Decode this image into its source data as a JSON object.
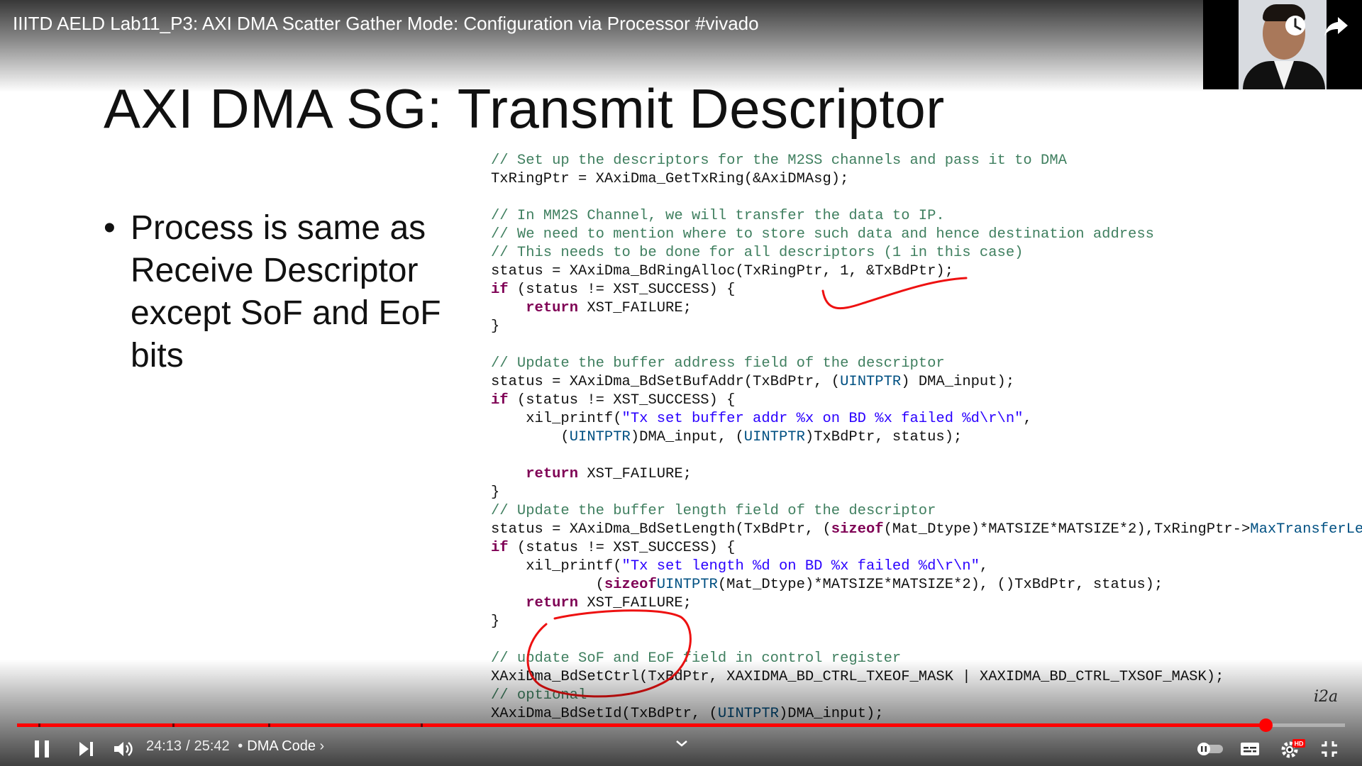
{
  "video": {
    "title": "IIITD AELD Lab11_P3: AXI DMA Scatter Gather Mode: Configuration via Processor #vivado"
  },
  "slide": {
    "title": "AXI DMA SG: Transmit Descriptor",
    "bullet_marker": "•",
    "bullet": "Process is same as Receive Descriptor except SoF and EoF bits",
    "code": [
      {
        "c": "// Set up the descriptors for the M2SS channels and pass it to DMA"
      },
      {
        "a": "TxRingPtr = XAxiDma_GetTxRing(&AxiDMAsg);"
      },
      {
        "a": ""
      },
      {
        "c": "// In MM2S Channel, we will transfer the data to IP."
      },
      {
        "c": "// We need to mention where to store such data and hence destination address"
      },
      {
        "c": "// This needs to be done for all descriptors (1 in this case)"
      },
      {
        "a": "status = XAxiDma_BdRingAlloc(TxRingPtr, 1, &TxBdPtr);"
      },
      {
        "kw": "if",
        "a": " (status != XST_SUCCESS) {"
      },
      {
        "i": "    ",
        "kw": "return",
        "a": " XST_FAILURE;"
      },
      {
        "a": "}"
      },
      {
        "a": ""
      },
      {
        "c": "// Update the buffer address field of the descriptor"
      },
      {
        "a": "status = XAxiDma_BdSetBufAddr(TxBdPtr, (",
        "t": "UINTPTR",
        "b": ") DMA_input);"
      },
      {
        "kw": "if",
        "a": " (status != XST_SUCCESS) {"
      },
      {
        "a": "    xil_printf(",
        "s": "\"Tx set buffer addr %x on BD %x failed %d\\r\\n\"",
        "b": ","
      },
      {
        "a": "        (",
        "t": "UINTPTR",
        "b": ")DMA_input, (",
        "t2": "UINTPTR",
        "b2": ")TxBdPtr, status);"
      },
      {
        "a": ""
      },
      {
        "i": "    ",
        "kw": "return",
        "a": " XST_FAILURE;"
      },
      {
        "a": "}"
      },
      {
        "c": "// Update the buffer length field of the descriptor"
      },
      {
        "a": "status = XAxiDma_BdSetLength(TxBdPtr, (",
        "kw2": "sizeof",
        "b": "(Mat_Dtype)*MATSIZE*MATSIZE*2),TxRingPtr->",
        "m": "MaxTransferLen",
        "b2": ");"
      },
      {
        "kw": "if",
        "a": " (status != XST_SUCCESS) {"
      },
      {
        "a": "    xil_printf(",
        "s": "\"Tx set length %d on BD %x failed %d\\r\\n\"",
        "b": ","
      },
      {
        "a": "            (",
        "kw2": "sizeof",
        "b": "(Mat_Dtype)*MATSIZE*MATSIZE*2), (",
        "t": "UINTPTR",
        "b2": ")TxBdPtr, status);"
      },
      {
        "i": "    ",
        "kw": "return",
        "a": " XST_FAILURE;"
      },
      {
        "a": "}"
      },
      {
        "a": ""
      },
      {
        "c": "// update SoF and EoF field in control register"
      },
      {
        "a": "XAxiDma_BdSetCtrl(TxBdPtr, XAXIDMA_BD_CTRL_TXEOF_MASK | XAXIDMA_BD_CTRL_TXSOF_MASK);"
      },
      {
        "c": "// optional"
      },
      {
        "a": "XAxiDma_BdSetId(TxBdPtr, (",
        "t": "UINTPTR",
        "b": ")DMA_input);"
      }
    ],
    "watermark": "i2a"
  },
  "player": {
    "progress_fraction": 0.94,
    "chapter_marks": [
      0.016,
      0.117,
      0.189,
      0.304
    ],
    "time_current": "24:13",
    "time_separator": "/",
    "time_total": "25:42",
    "chapter_separator": "•",
    "chapter": "DMA Code",
    "chapter_arrow": "›",
    "icons": [
      "pause-icon",
      "next-icon",
      "volume-icon",
      "chevron-down-icon",
      "autoplay-toggle-icon",
      "subtitles-icon",
      "settings-icon",
      "fullscreen-exit-icon",
      "watch-later-icon",
      "share-icon"
    ],
    "badge": "HD",
    "accent_color": "#ff0000"
  }
}
